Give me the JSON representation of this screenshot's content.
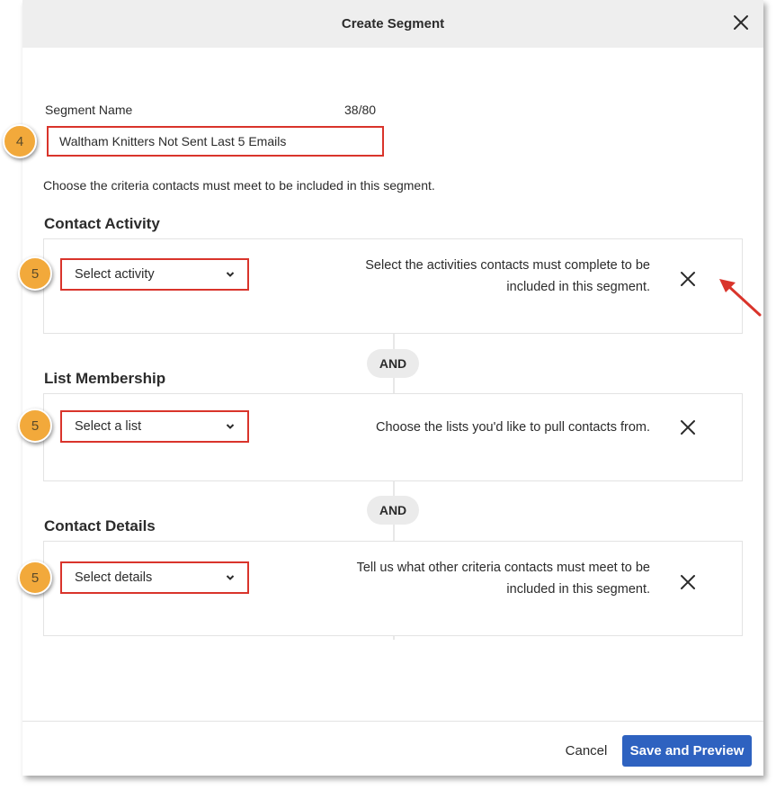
{
  "dialog": {
    "title": "Create Segment"
  },
  "segment_name": {
    "label": "Segment Name",
    "counter": "38/80",
    "value": "Waltham Knitters Not Sent Last 5 Emails"
  },
  "intro": "Choose the criteria contacts must meet to be included in this segment.",
  "sections": {
    "activity": {
      "title": "Contact Activity",
      "select": "Select activity",
      "help": "Select the activities contacts must complete to be included in this segment."
    },
    "list": {
      "title": "List Membership",
      "select": "Select a list",
      "help": "Choose the lists you'd like to pull contacts from."
    },
    "details": {
      "title": "Contact Details",
      "select": "Select details",
      "help": "Tell us what other criteria contacts must meet to be included in this segment."
    }
  },
  "connectors": {
    "and_1": "AND",
    "and_2": "AND"
  },
  "badges": {
    "name_step": "4",
    "activity_step": "5",
    "list_step": "5",
    "details_step": "5"
  },
  "footer": {
    "cancel": "Cancel",
    "save": "Save and Preview"
  },
  "colors": {
    "highlight": "#d9342b",
    "badge": "#f2a93b",
    "primary": "#2e62c0",
    "header_bg": "#eeeeee"
  },
  "icons": {
    "close": "close-icon",
    "remove": "x-icon",
    "dropdown": "chevron-down-icon",
    "annotation": "arrow-icon"
  }
}
